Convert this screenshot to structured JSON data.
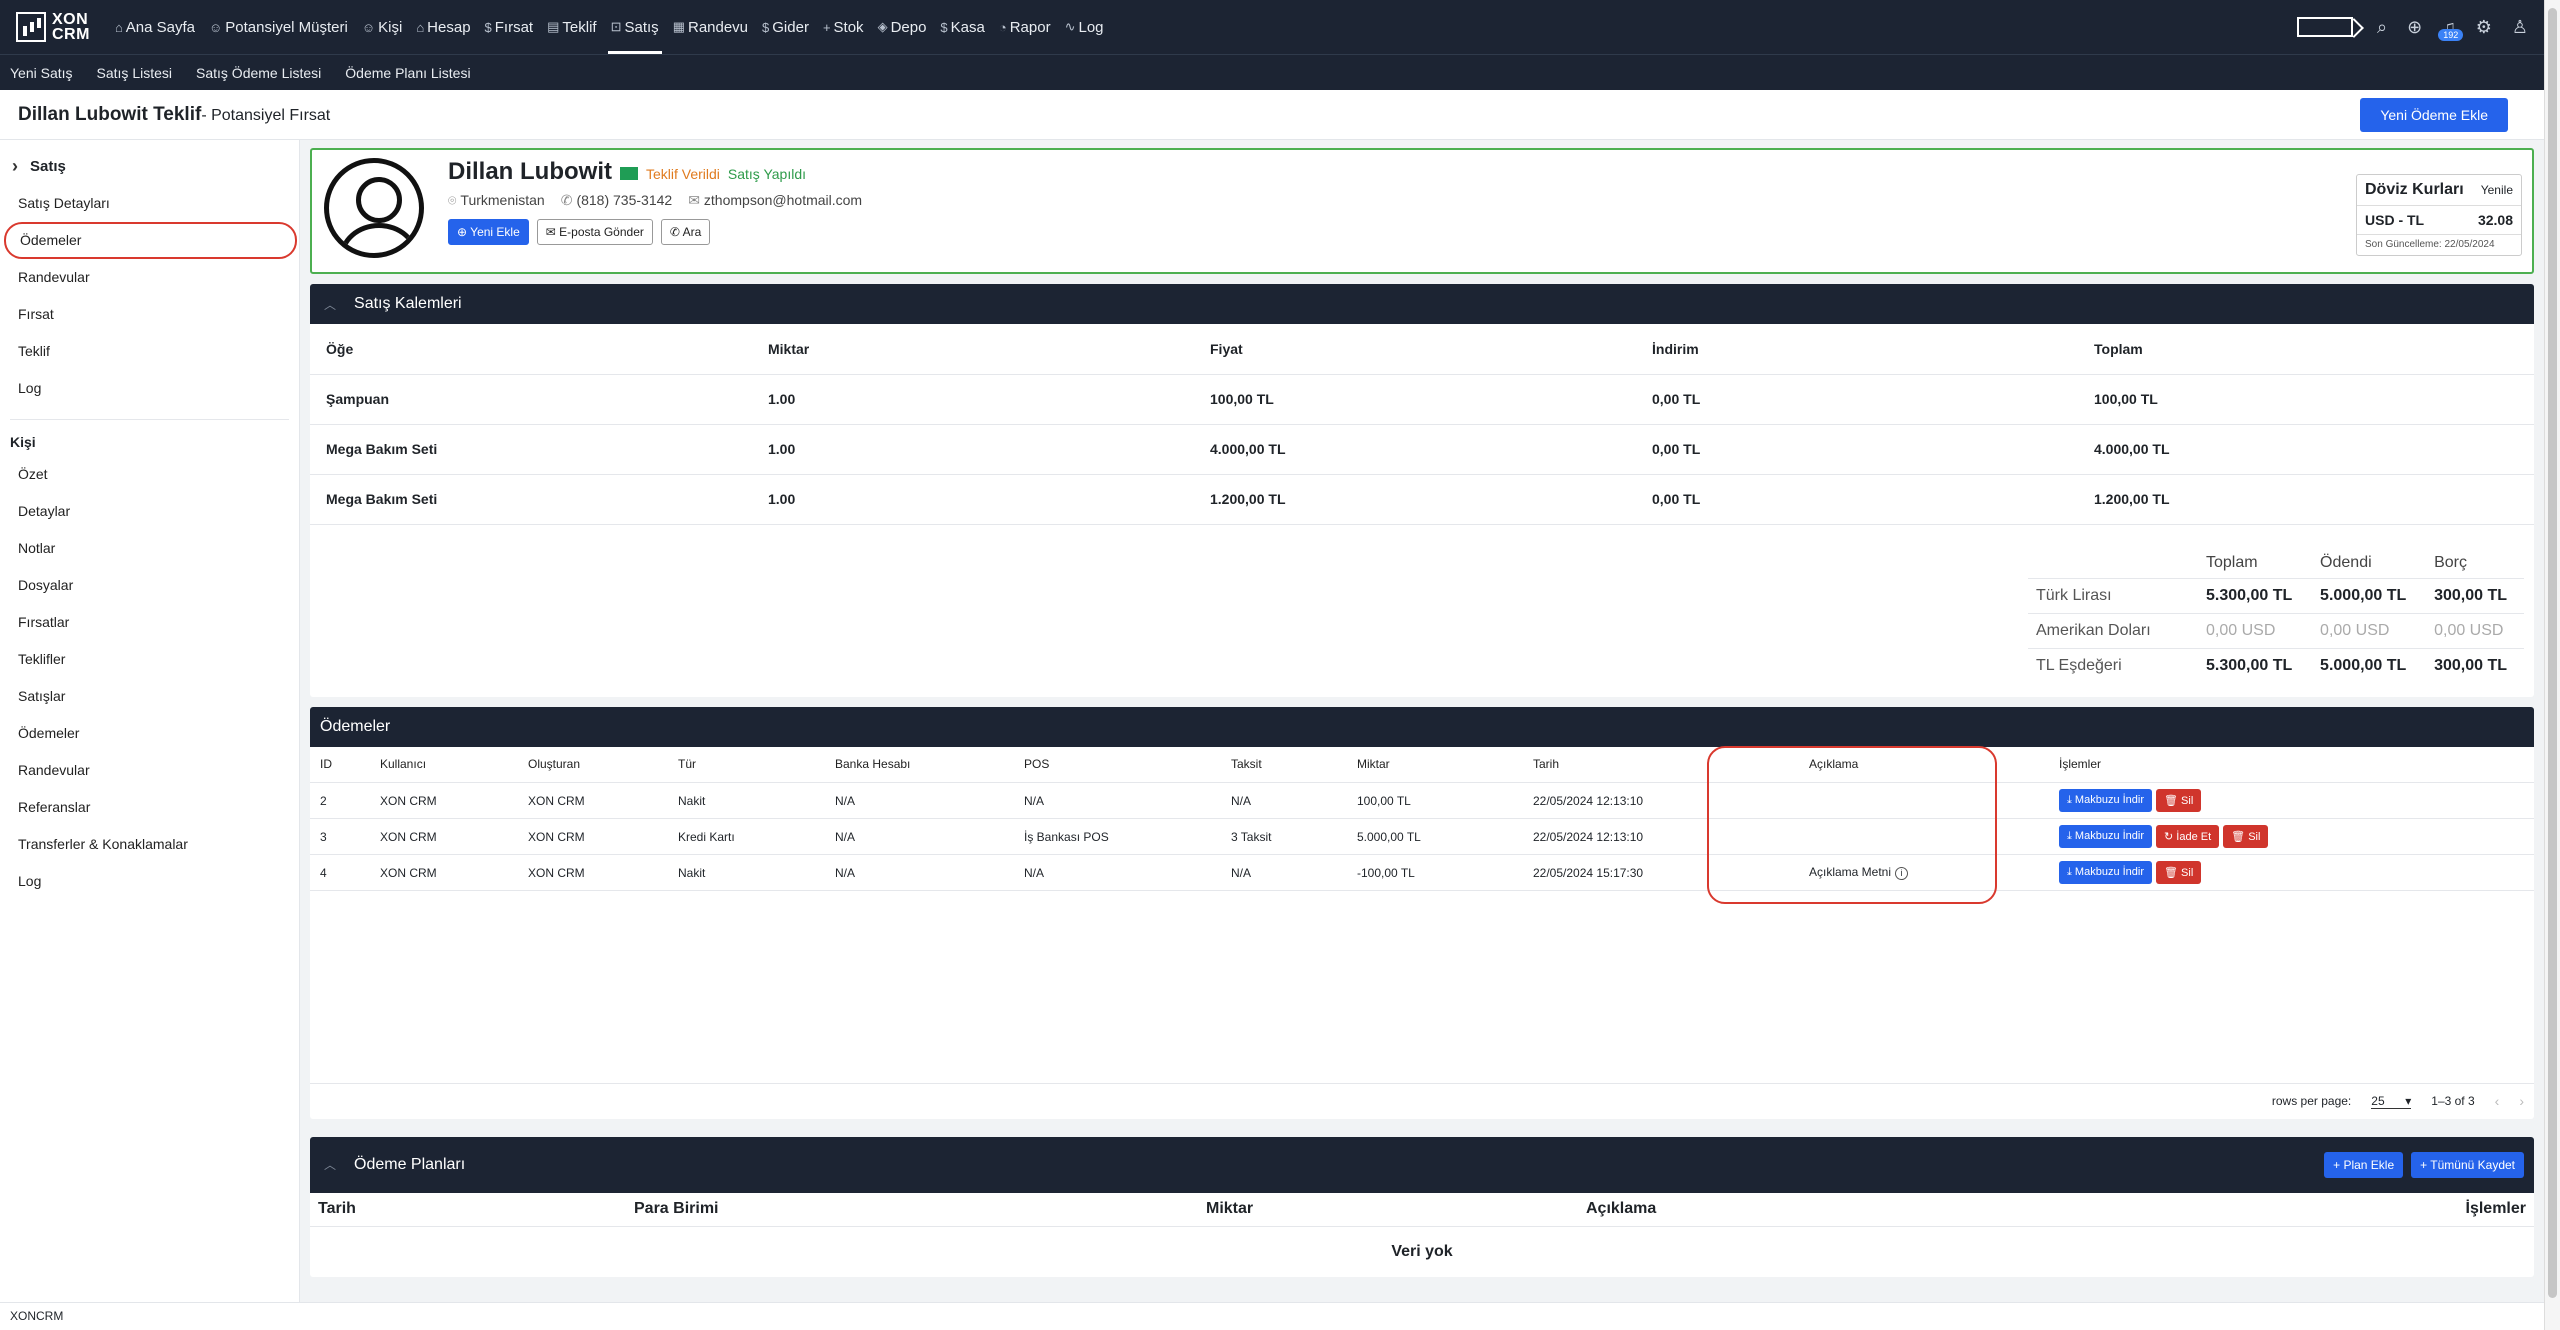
{
  "brand": {
    "line1": "XON",
    "line2": "CRM"
  },
  "nav": [
    {
      "icon": "⌂",
      "label": "Ana Sayfa"
    },
    {
      "icon": "☺",
      "label": "Potansiyel Müşteri"
    },
    {
      "icon": "☺",
      "label": "Kişi"
    },
    {
      "icon": "⌂",
      "label": "Hesap"
    },
    {
      "icon": "$",
      "label": "Fırsat"
    },
    {
      "icon": "▤",
      "label": "Teklif"
    },
    {
      "icon": "⊡",
      "label": "Satış"
    },
    {
      "icon": "▦",
      "label": "Randevu"
    },
    {
      "icon": "$",
      "label": "Gider"
    },
    {
      "icon": "+",
      "label": "Stok"
    },
    {
      "icon": "◈",
      "label": "Depo"
    },
    {
      "icon": "$",
      "label": "Kasa"
    },
    {
      "icon": "◔",
      "label": "Rapor"
    },
    {
      "icon": "∿",
      "label": "Log"
    }
  ],
  "notification_count": "192",
  "subnav": [
    "Yeni Satış",
    "Satış Listesi",
    "Satış Ödeme Listesi",
    "Ödeme Planı Listesi"
  ],
  "page": {
    "title": "Dillan Lubowit Teklif",
    "subtitle": "- Potansiyel Fırsat",
    "new_payment": "Yeni Ödeme Ekle"
  },
  "sidebar": {
    "section1": "Satış",
    "items1": [
      "Satış Detayları",
      "Ödemeler",
      "Randevular",
      "Fırsat",
      "Teklif",
      "Log"
    ],
    "section2": "Kişi",
    "items2": [
      "Özet",
      "Detaylar",
      "Notlar",
      "Dosyalar",
      "Fırsatlar",
      "Teklifler",
      "Satışlar",
      "Ödemeler",
      "Randevular",
      "Referanslar",
      "Transferler & Konaklamalar",
      "Log"
    ]
  },
  "profile": {
    "name": "Dillan Lubowit",
    "status1": "Teklif Verildi",
    "status2": "Satış Yapıldı",
    "country": "Turkmenistan",
    "phone": "(818) 735-3142",
    "email": "zthompson@hotmail.com",
    "btn_new": "Yeni Ekle",
    "btn_email": "E-posta Gönder",
    "btn_call": "Ara"
  },
  "fx": {
    "title": "Döviz Kurları",
    "refresh": "Yenile",
    "pair": "USD - TL",
    "rate": "32.08",
    "updated": "Son Güncelleme: 22/05/2024"
  },
  "items": {
    "title": "Satış Kalemleri",
    "columns": [
      "Öğe",
      "Miktar",
      "Fiyat",
      "İndirim",
      "Toplam"
    ],
    "rows": [
      [
        "Şampuan",
        "1.00",
        "100,00 TL",
        "0,00 TL",
        "100,00 TL"
      ],
      [
        "Mega Bakım Seti",
        "1.00",
        "4.000,00 TL",
        "0,00 TL",
        "4.000,00 TL"
      ],
      [
        "Mega Bakım Seti",
        "1.00",
        "1.200,00 TL",
        "0,00 TL",
        "1.200,00 TL"
      ]
    ]
  },
  "totals": {
    "columns": [
      "Toplam",
      "Ödendi",
      "Borç"
    ],
    "rows": [
      [
        "Türk Lirası",
        "5.300,00 TL",
        "5.000,00 TL",
        "300,00 TL"
      ],
      [
        "Amerikan Doları",
        "0,00 USD",
        "0,00 USD",
        "0,00 USD"
      ],
      [
        "TL Eşdeğeri",
        "5.300,00 TL",
        "5.000,00 TL",
        "300,00 TL"
      ]
    ]
  },
  "payments": {
    "title": "Ödemeler",
    "columns": [
      "ID",
      "Kullanıcı",
      "Oluşturan",
      "Tür",
      "Banka Hesabı",
      "POS",
      "Taksit",
      "Miktar",
      "Tarih",
      "Açıklama",
      "İşlemler"
    ],
    "rows": [
      [
        "2",
        "XON CRM",
        "XON CRM",
        "Nakit",
        "N/A",
        "N/A",
        "N/A",
        "100,00 TL",
        "22/05/2024 12:13:10",
        ""
      ],
      [
        "3",
        "XON CRM",
        "XON CRM",
        "Kredi Kartı",
        "N/A",
        "İş Bankası POS",
        "3 Taksit",
        "5.000,00 TL",
        "22/05/2024 12:13:10",
        ""
      ],
      [
        "4",
        "XON CRM",
        "XON CRM",
        "Nakit",
        "N/A",
        "N/A",
        "N/A",
        "-100,00 TL",
        "22/05/2024 15:17:30",
        "Açıklama Metni"
      ]
    ],
    "btn_receipt": "Makbuzu İndir",
    "btn_refund": "İade Et",
    "btn_delete": "Sil",
    "rows_per_page_label": "rows per page:",
    "rows_per_page": "25",
    "range": "1–3 of 3"
  },
  "plans": {
    "title": "Ödeme Planları",
    "btn_add": "Plan Ekle",
    "btn_save": "Tümünü Kaydet",
    "columns": [
      "Tarih",
      "Para Birimi",
      "Miktar",
      "Açıklama",
      "İşlemler"
    ],
    "empty": "Veri yok"
  },
  "footer": "XONCRM"
}
